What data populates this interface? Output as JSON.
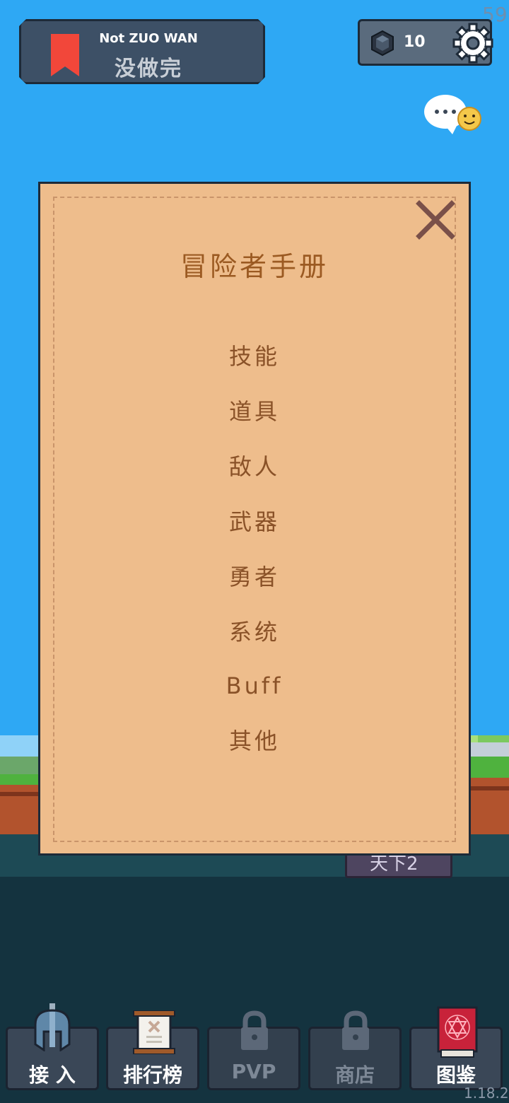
{
  "fps": "59",
  "title_badge": {
    "subtitle": "Not ZUO WAN",
    "title": "没做完"
  },
  "currency": {
    "gem_count": "10",
    "icon": "gem-icon"
  },
  "settings_icon": "gear-icon",
  "chat_icon": "chat-bubble-icon",
  "under_button_label": "天下2",
  "dialog": {
    "title": "冒险者手册",
    "close_icon": "close-icon",
    "items": [
      {
        "label": "技能"
      },
      {
        "label": "道具"
      },
      {
        "label": "敌人"
      },
      {
        "label": "武器"
      },
      {
        "label": "勇者"
      },
      {
        "label": "系统"
      },
      {
        "label": "Buff"
      },
      {
        "label": "其他"
      }
    ]
  },
  "nav": [
    {
      "label": "接 入",
      "icon": "helmet-icon",
      "locked": false
    },
    {
      "label": "排行榜",
      "icon": "scroll-icon",
      "locked": false
    },
    {
      "label": "PVP",
      "icon": "lock-icon",
      "locked": true
    },
    {
      "label": "商店",
      "icon": "lock-icon",
      "locked": true
    },
    {
      "label": "图鉴",
      "icon": "spellbook-icon",
      "locked": false
    }
  ],
  "version": "1.18.2",
  "colors": {
    "sky": "#2ea8f4",
    "parchment": "#eebd8c",
    "parchment_text": "#8a5228",
    "panel": "#3d5066",
    "bookmark": "#f2473a"
  }
}
